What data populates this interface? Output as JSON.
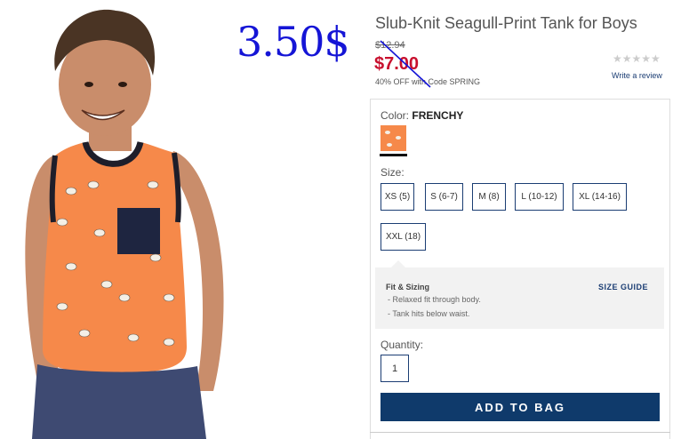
{
  "overlay_price": "3.50$",
  "product": {
    "title": "Slub-Knit Seagull-Print Tank for Boys",
    "old_price": "$12.94",
    "sale_price": "$7.00",
    "promo": "40% OFF with Code SPRING"
  },
  "rating": {
    "stars": "★★★★★",
    "write_review": "Write a review"
  },
  "color": {
    "label": "Color:",
    "value": "FRENCHY",
    "swatch_color": "#f6894a"
  },
  "sizes": {
    "label": "Size:",
    "options": [
      "XS (5)",
      "S (6-7)",
      "M (8)",
      "L (10-12)",
      "XL (14-16)",
      "XXL (18)"
    ]
  },
  "fit": {
    "title": "Fit & Sizing",
    "size_guide": "SIZE GUIDE",
    "items": [
      "- Relaxed fit through body.",
      "- Tank hits below waist."
    ]
  },
  "quantity": {
    "label": "Quantity:",
    "value": "1"
  },
  "add_to_bag": "ADD TO BAG",
  "colors": {
    "accent": "#0f3a6b",
    "sale": "#c8102e",
    "tank": "#f6894a",
    "overlay": "#1515d6"
  }
}
